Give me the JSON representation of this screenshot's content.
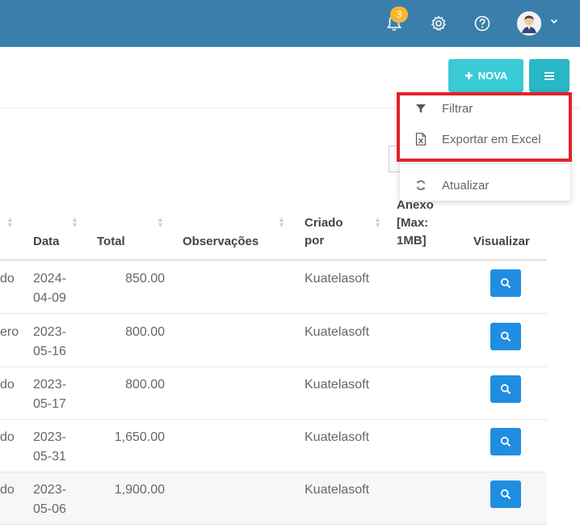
{
  "topbar": {
    "notifications_count": "3"
  },
  "toolbar": {
    "nova_label": "NOVA"
  },
  "dropdown": {
    "items": [
      {
        "label": "Filtrar",
        "icon": "filter-icon"
      },
      {
        "label": "Exportar em Excel",
        "icon": "excel-file-icon"
      },
      {
        "label": "Atualizar",
        "icon": "refresh-icon"
      }
    ]
  },
  "table": {
    "headers": {
      "data": "Data",
      "total": "Total",
      "observacoes": "Observações",
      "criado_line1": "Criado",
      "criado_line2": "por",
      "anexo_line1": "Anexo",
      "anexo_line2": "[Max:",
      "anexo_line3": "1MB]",
      "visualizar": "Visualizar"
    },
    "rows": [
      {
        "partial": "do",
        "date1": "2024-",
        "date2": "04-09",
        "total": "850.00",
        "criado": "Kuatelasoft"
      },
      {
        "partial": "ero",
        "date1": "2023-",
        "date2": "05-16",
        "total": "800.00",
        "criado": "Kuatelasoft"
      },
      {
        "partial": "do",
        "date1": "2023-",
        "date2": "05-17",
        "total": "800.00",
        "criado": "Kuatelasoft"
      },
      {
        "partial": "do",
        "date1": "2023-",
        "date2": "05-31",
        "total": "1,650.00",
        "criado": "Kuatelasoft"
      },
      {
        "partial": "do",
        "date1": "2023-",
        "date2": "05-06",
        "total": "1,900.00",
        "criado": "Kuatelasoft"
      }
    ]
  },
  "colors": {
    "topbar": "#3a7fab",
    "nova_button": "#3bcbd6",
    "menu_button": "#29b6c5",
    "highlight": "#e3222a",
    "view_button": "#1f8ee0",
    "badge": "#f5b731"
  }
}
